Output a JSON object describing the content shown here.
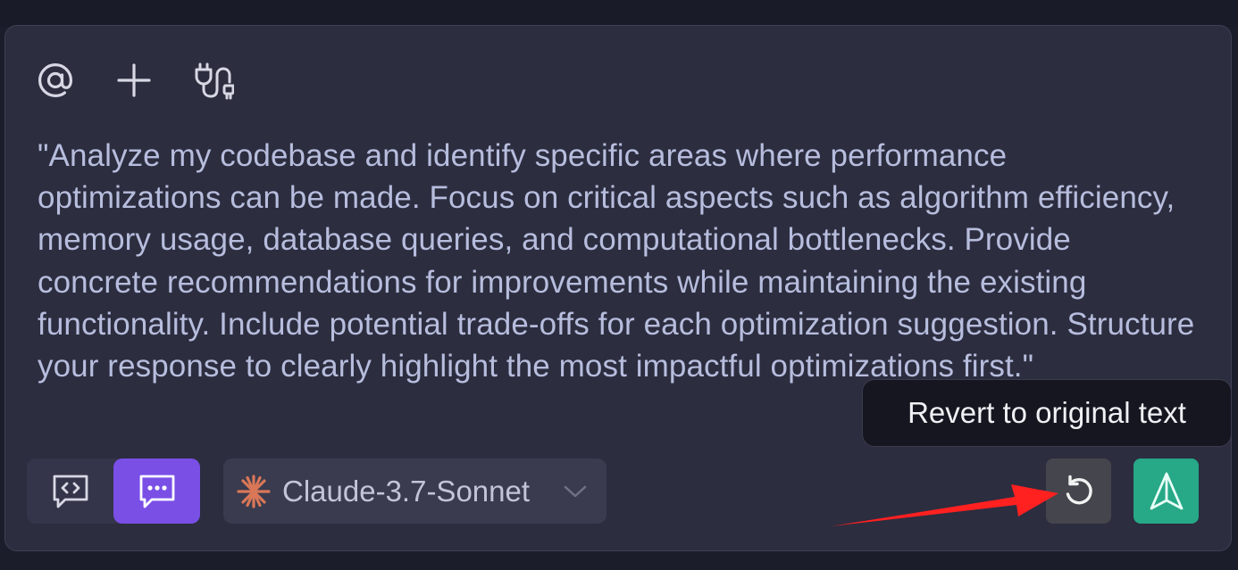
{
  "toolbar": {
    "mention_icon": "at-icon",
    "add_icon": "plus-icon",
    "plugin_icon": "plug-icon"
  },
  "prompt": {
    "text": "\"Analyze my codebase and identify specific areas where performance optimizations can be made. Focus on critical aspects such as algorithm efficiency, memory usage, database queries, and computational bottlenecks. Provide concrete recommendations for improvements while maintaining the existing functionality. Include potential trade-offs for each optimization suggestion. Structure your response to clearly highlight the most impactful optimizations first.\""
  },
  "mode": {
    "code_icon": "code-chat-icon",
    "chat_icon": "chat-icon",
    "active": "chat"
  },
  "model": {
    "label": "Claude-3.7-Sonnet",
    "icon": "claude-spark-icon",
    "icon_color": "#d97757"
  },
  "tooltip": {
    "text": "Revert to original text"
  },
  "actions": {
    "revert_icon": "revert-icon",
    "send_icon": "send-icon",
    "send_color": "#27a887"
  },
  "annotation": {
    "arrow_color": "#ff2020"
  }
}
